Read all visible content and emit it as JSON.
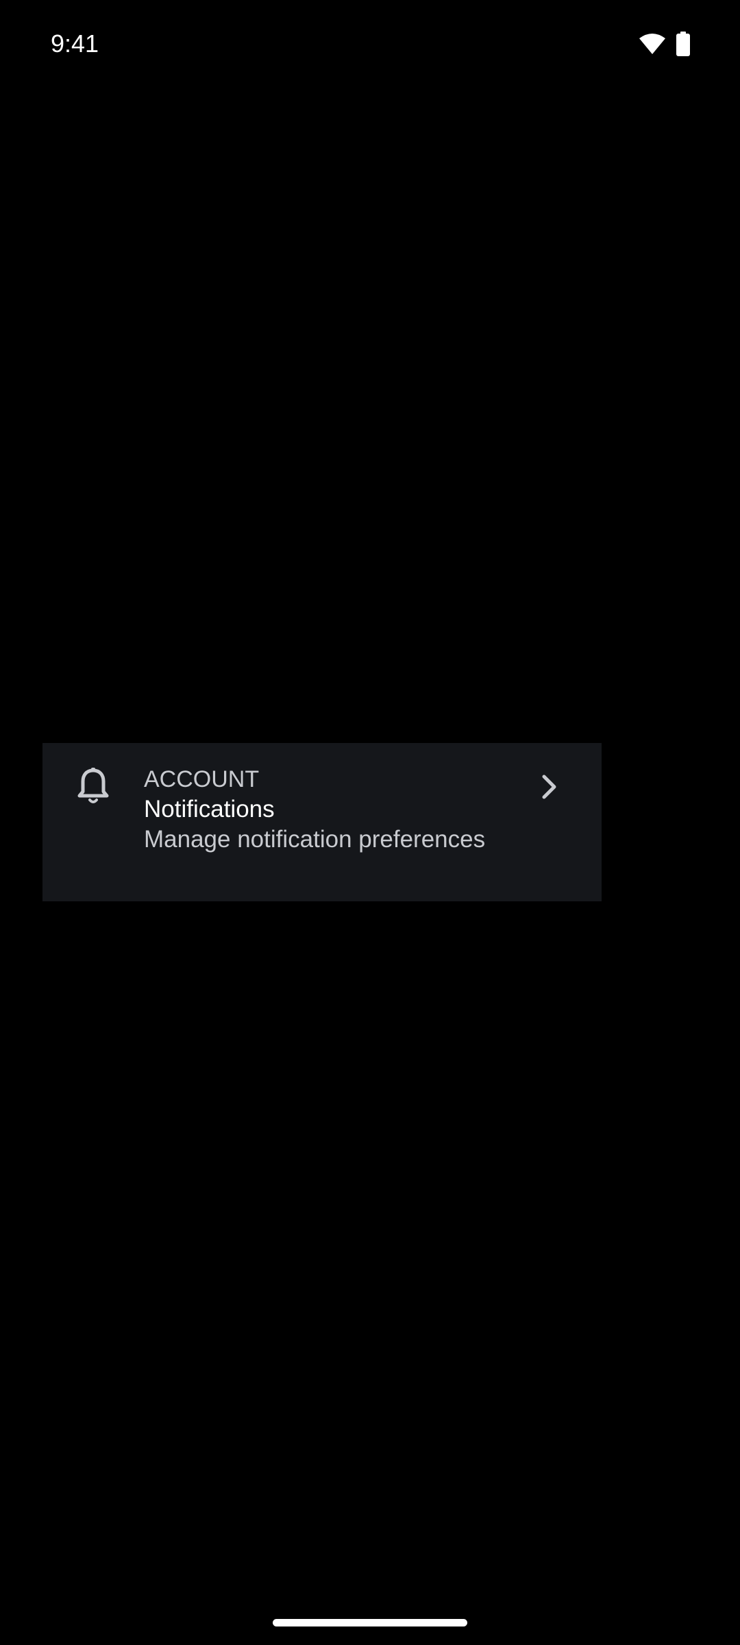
{
  "status_bar": {
    "time": "9:41",
    "icons": [
      "wifi-icon",
      "battery-icon"
    ]
  },
  "settings_item": {
    "icon": "bell-icon",
    "category": "ACCOUNT",
    "title": "Notifications",
    "subtitle": "Manage notification preferences",
    "trailing_icon": "chevron-right-icon"
  },
  "colors": {
    "background": "#000000",
    "card": "#15171b",
    "primary_text": "#ffffff",
    "secondary_text": "#c9cbd0"
  }
}
